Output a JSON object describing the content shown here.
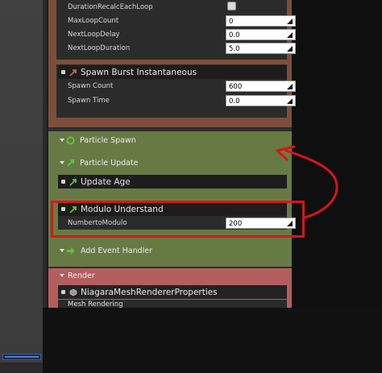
{
  "emitter_properties": [
    {
      "label": "DurationRecalcEachLoop",
      "type": "checkbox"
    },
    {
      "label": "MaxLoopCount",
      "value": "0"
    },
    {
      "label": "NextLoopDelay",
      "value": "0.0"
    },
    {
      "label": "NextLoopDuration",
      "value": "5.0"
    }
  ],
  "spawn_burst": {
    "title": "Spawn Burst Instantaneous",
    "props": [
      {
        "label": "Spawn Count",
        "value": "600"
      },
      {
        "label": "Spawn Time",
        "value": "0.0"
      }
    ]
  },
  "particle_spawn": {
    "label": "Particle Spawn"
  },
  "particle_update": {
    "label": "Particle Update"
  },
  "update_age": {
    "title": "Update Age"
  },
  "modulo": {
    "title": "Modulo Understand",
    "prop_label": "NumbertoModulo",
    "prop_value": "200"
  },
  "add_event_handler": {
    "label": "Add Event Handler"
  },
  "render": {
    "title": "Render",
    "mesh_renderer_title": "NiagaraMeshRendererProperties",
    "mesh_rendering_label": "Mesh Rendering"
  },
  "colors": {
    "emitter_brown": "#7b4f3a",
    "update_green": "#677a44",
    "render_red": "#b45d5d",
    "annotation_red": "#d8151a",
    "icon_green": "#5cc23a"
  }
}
